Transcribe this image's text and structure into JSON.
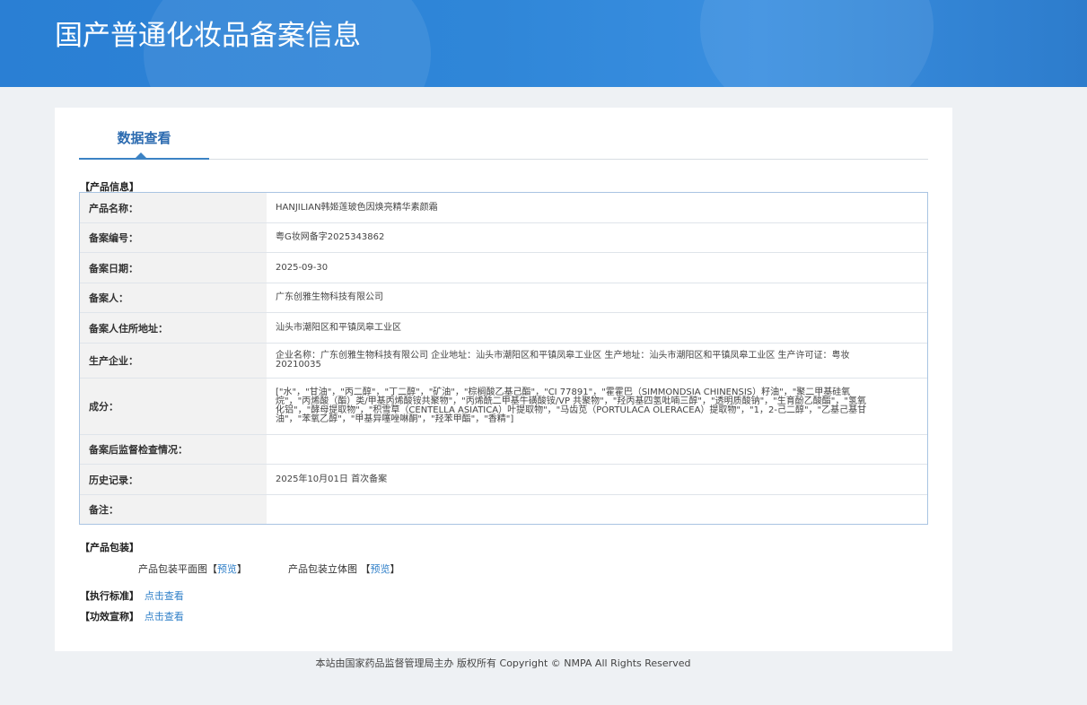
{
  "header": {
    "title": "国产普通化妆品备案信息"
  },
  "tabs": [
    {
      "label": "数据查看"
    }
  ],
  "product_info": {
    "section_label": "【产品信息】",
    "rows": [
      {
        "label": "产品名称：",
        "value": "HANJILIAN韩姬莲玻色因焕亮精华素颜霜"
      },
      {
        "label": "备案编号：",
        "value": "粤G妆网备字2025343862"
      },
      {
        "label": "备案日期：",
        "value": "2025-09-30"
      },
      {
        "label": "备案人：",
        "value": "广东创雅生物科技有限公司"
      },
      {
        "label": "备案人住所地址：",
        "value": "汕头市潮阳区和平镇凤皋工业区"
      },
      {
        "label": "生产企业：",
        "value": "企业名称：广东创雅生物科技有限公司 企业地址：汕头市潮阳区和平镇凤皋工业区 生产地址：汕头市潮阳区和平镇凤皋工业区 生产许可证：粤妆20210035"
      },
      {
        "label": "成分：",
        "value": "[\"水\"，\"甘油\"，\"丙二醇\"，\"丁二醇\"，\"矿油\"，\"棕榈酸乙基己酯\"，\"CI 77891\"，\"霍霍巴（SIMMONDSIA CHINENSIS）籽油\"，\"聚二甲基硅氧烷\"，\"丙烯酸（酯）类/甲基丙烯酸铵共聚物\"，\"丙烯酰二甲基牛磺酸铵/VP 共聚物\"，\"羟丙基四氢吡喃三醇\"，\"透明质酸钠\"，\"生育酚乙酸酯\"，\"氢氧化铝\"，\"酵母提取物\"，\"积雪草（CENTELLA ASIATICA）叶提取物\"，\"马齿苋（PORTULACA OLERACEA）提取物\"，\"1，2-己二醇\"，\"乙基己基甘油\"，\"苯氧乙醇\"，\"甲基异噻唑啉酮\"，\"羟苯甲酯\"，\"香精\"]"
      },
      {
        "label": "备案后监督检查情况：",
        "value": ""
      },
      {
        "label": "历史记录：",
        "value": "2025年10月01日 首次备案"
      },
      {
        "label": "备注：",
        "value": ""
      }
    ]
  },
  "packaging": {
    "section_label": "【产品包装】",
    "plan_label": "产品包装平面图",
    "solid_label": "产品包装立体图",
    "preview_link": "预览",
    "bracket_open": "【",
    "bracket_close": "】"
  },
  "standard": {
    "label": "【执行标准】",
    "link": "点击查看"
  },
  "claims": {
    "label": "【功效宣称】",
    "link": "点击查看"
  },
  "footer": {
    "text": "本站由国家药品监督管理局主办 版权所有 Copyright © NMPA All Rights Reserved"
  }
}
